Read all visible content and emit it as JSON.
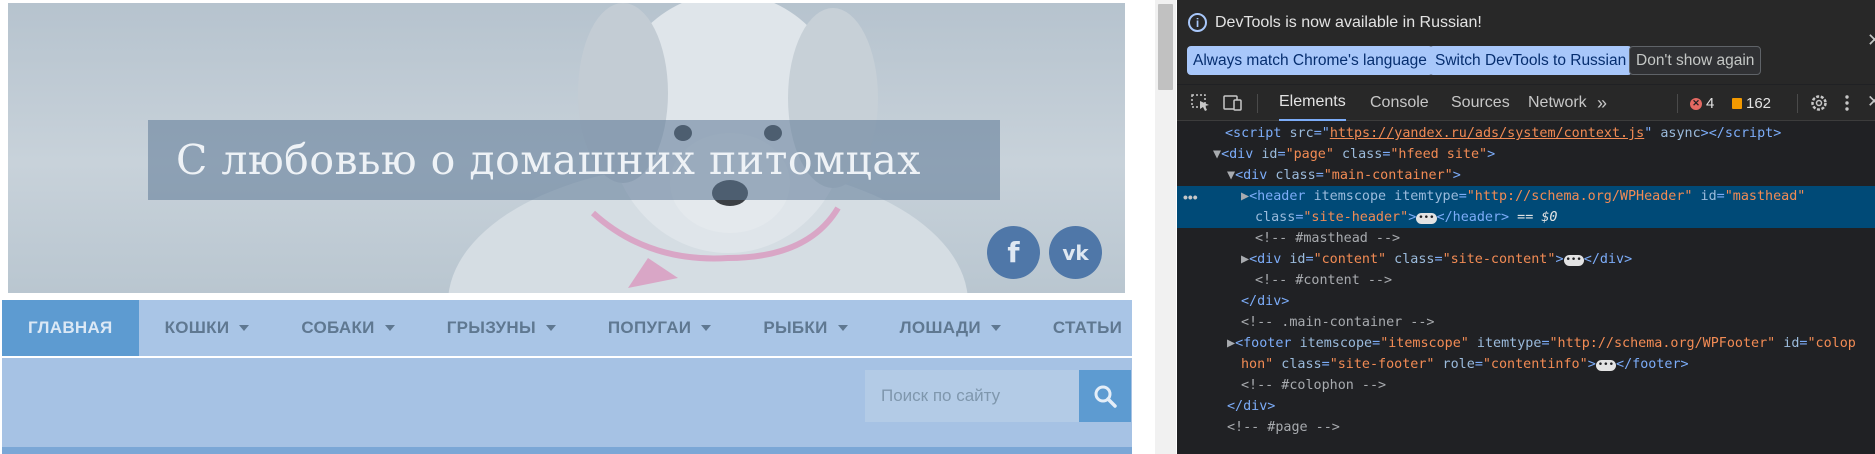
{
  "page": {
    "site_title": "С любовью о домашних питомцах",
    "social": {
      "facebook_glyph": "f",
      "vk_glyph": "vk"
    },
    "nav": [
      {
        "label": "ГЛАВНАЯ",
        "active": true,
        "dropdown": false
      },
      {
        "label": "КОШКИ",
        "active": false,
        "dropdown": true
      },
      {
        "label": "СОБАКИ",
        "active": false,
        "dropdown": true
      },
      {
        "label": "ГРЫЗУНЫ",
        "active": false,
        "dropdown": true
      },
      {
        "label": "ПОПУГАИ",
        "active": false,
        "dropdown": true
      },
      {
        "label": "РЫБКИ",
        "active": false,
        "dropdown": true
      },
      {
        "label": "ЛОШАДИ",
        "active": false,
        "dropdown": true
      },
      {
        "label": "СТАТЬИ",
        "active": false,
        "dropdown": false
      }
    ],
    "search": {
      "placeholder": "Поиск по сайту",
      "icon": "search-icon"
    }
  },
  "devtools": {
    "info_bar": {
      "message": "DevTools is now available in Russian!",
      "buttons": {
        "match": "Always match Chrome's language",
        "switch": "Switch DevTools to Russian",
        "dont_show": "Don't show again"
      }
    },
    "tabs": {
      "elements": "Elements",
      "console": "Console",
      "sources": "Sources",
      "network": "Network",
      "more": "»"
    },
    "counts": {
      "errors": "4",
      "warnings": "162"
    },
    "dom": {
      "l1_src": "https://yandex.ru/ads/system/context.js",
      "l1_async": "async",
      "l2_id": "\"page\"",
      "l2_class": "\"hfeed site\"",
      "l3_class": "\"main-container\"",
      "l4_itemtype": "\"http://schema.org/WPHeader\"",
      "l4_id": "\"masthead\"",
      "l5_class": "\"site-header\"",
      "l5_suffix": "== ",
      "l5_var": "$0",
      "c_masthead": "<!-- #masthead -->",
      "l7_id": "\"content\"",
      "l7_class": "\"site-content\"",
      "c_content": "<!-- #content -->",
      "c_main": "<!-- .main-container -->",
      "l11_itemscope": "\"itemscope\"",
      "l11_itemtype": "\"http://schema.org/WPFooter\"",
      "l11_id": "\"colop",
      "l12_id_cont": "hon\"",
      "l12_class": "\"site-footer\"",
      "l12_role": "\"contentinfo\"",
      "c_colophon": "<!-- #colophon -->",
      "c_page": "<!-- #page -->"
    },
    "colors": {
      "selected_row": "#004a77",
      "accent": "#7cacf8",
      "attr_value": "#f28b54"
    }
  }
}
